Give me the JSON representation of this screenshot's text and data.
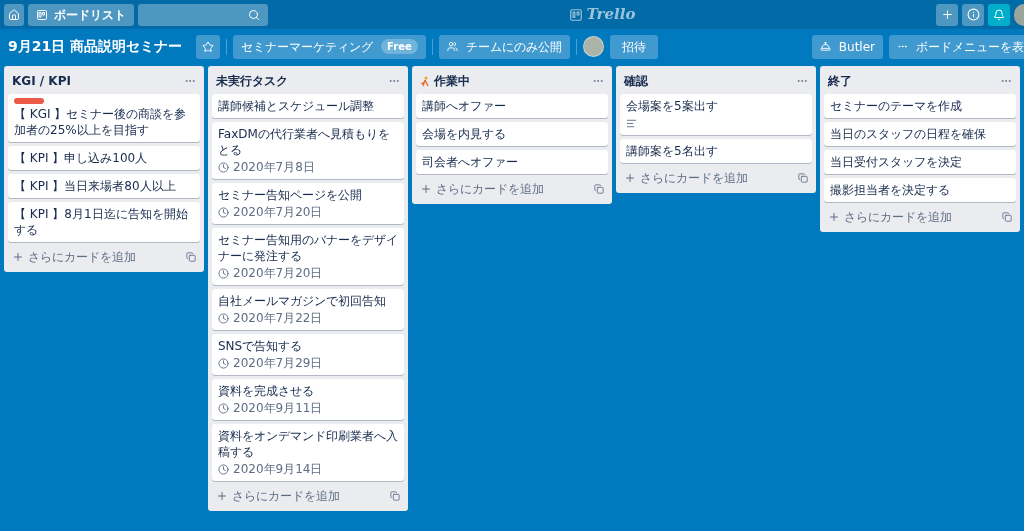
{
  "top_bar": {
    "board_list_button": "ボードリスト",
    "logo": "Trello",
    "notifications_active": true
  },
  "board": {
    "title": "9月21日 商品説明セミナー",
    "starred": false,
    "team": "セミナーマーケティング",
    "team_badge": "Free",
    "visibility": "チームにのみ公開",
    "invite": "招待",
    "butler": "Butler",
    "menu": "ボードメニューを表"
  },
  "lists": [
    {
      "title": "KGI / KPI",
      "has_icon": false,
      "cards": [
        {
          "labels": [
            {
              "color": "#eb5a46"
            }
          ],
          "title": "【 KGI 】セミナー後の商談を参加者の25%以上を目指す"
        },
        {
          "title": "【 KPI 】申し込み100人"
        },
        {
          "title": "【 KPI 】当日来場者80人以上"
        },
        {
          "title": "【 KPI 】8月1日迄に告知を開始する"
        }
      ],
      "add_card": "さらにカードを追加"
    },
    {
      "title": "未実行タスク",
      "has_icon": false,
      "cards": [
        {
          "title": "講師候補とスケジュール調整"
        },
        {
          "title": "FaxDMの代行業者へ見積もりをとる",
          "due": "2020年7月8日"
        },
        {
          "title": "セミナー告知ページを公開",
          "due": "2020年7月20日"
        },
        {
          "title": "セミナー告知用のバナーをデザイナーに発注する",
          "due": "2020年7月20日"
        },
        {
          "title": "自社メールマガジンで初回告知",
          "due": "2020年7月22日"
        },
        {
          "title": "SNSで告知する",
          "due": "2020年7月29日"
        },
        {
          "title": "資料を完成させる",
          "due": "2020年9月11日"
        },
        {
          "title": "資料をオンデマンド印刷業者へ入稿する",
          "due": "2020年9月14日"
        }
      ],
      "add_card": "さらにカードを追加"
    },
    {
      "title": "作業中",
      "has_icon": true,
      "cards": [
        {
          "title": "講師へオファー"
        },
        {
          "title": "会場を内見する"
        },
        {
          "title": "司会者へオファー"
        }
      ],
      "add_card": "さらにカードを追加"
    },
    {
      "title": "確認",
      "has_icon": false,
      "cards": [
        {
          "title": "会場案を5案出す",
          "has_description": true
        },
        {
          "title": "講師案を5名出す"
        }
      ],
      "add_card": "さらにカードを追加"
    },
    {
      "title": "終了",
      "has_icon": false,
      "cards": [
        {
          "title": "セミナーのテーマを作成"
        },
        {
          "title": "当日のスタッフの日程を確保"
        },
        {
          "title": "当日受付スタッフを決定"
        },
        {
          "title": "撮影担当者を決定する"
        }
      ],
      "add_card": "さらにカードを追加"
    }
  ]
}
